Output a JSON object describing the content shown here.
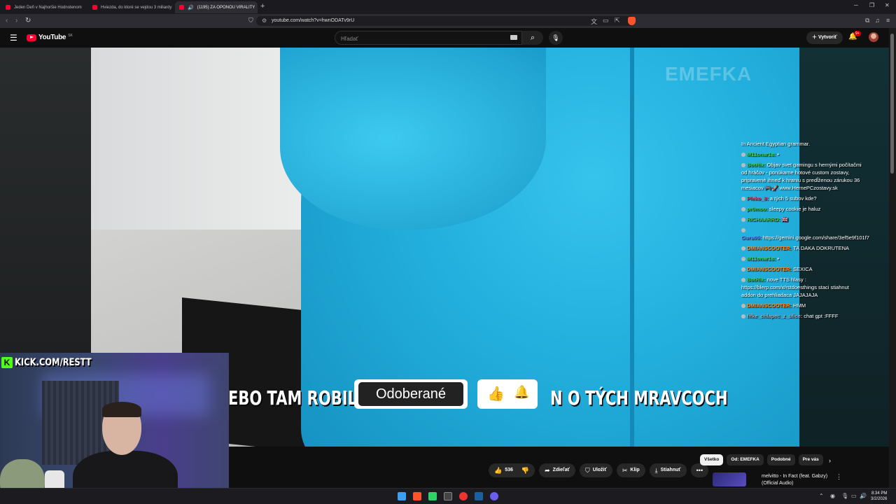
{
  "browser": {
    "tabs": [
      {
        "label": "Jeden Deň v Najhoršie Hodnotenom"
      },
      {
        "label": "Hviezda, do ktoré se vejdou 3 miliardy"
      },
      {
        "label": "(1195) ZA OPONOU VIRALITY"
      }
    ],
    "url": "youtube.com/watch?v=hwnODATv9rU",
    "colors": {
      "brave": "#fb542b",
      "youtube_red": "#ff0033"
    }
  },
  "header": {
    "logo_text": "YouTube",
    "country_code": "SK",
    "search_placeholder": "Hľadať",
    "create_label": "Vytvoriť",
    "notification_count": "9+"
  },
  "video": {
    "watermark": "EMEFKA",
    "caption_left": "EBO TAM ROBIL ZLE",
    "caption_right": "N   O TÝCH MRAVCOCH",
    "subscribed_label": "Odoberané"
  },
  "chat": [
    {
      "user": "",
      "text": "In Ancient Egyptian grammar.",
      "color": "#ffffff"
    },
    {
      "user": "M11onar1s:",
      "text": "▪",
      "color": "#3ad13a"
    },
    {
      "user": "BotRix:",
      "text": "Objav svet gamingu s hernými počítačmi od hráčov - ponúkame hotové custom zostavy, pripravené ihneď k hraniu s predĺženou zárukou 36 mesiacov 🎮🚀 www.HernePCzostavy.sk",
      "color": "#3ad13a"
    },
    {
      "user": "Pleko_8:",
      "text": "a tých 5 subov kde?",
      "color": "#ff3b6b"
    },
    {
      "user": "pr0moo:",
      "text": "sleepy cookie je haluz",
      "color": "#3ad13a"
    },
    {
      "user": "RICHAARRD:",
      "text": "🇬🇧",
      "color": "#3ad13a"
    },
    {
      "user": "Guru05:",
      "text": "https://gemini.google.com/share/3ef5e9f101f7",
      "color": "#6a8cff"
    },
    {
      "user": "DMIANSCOOTER:",
      "text": "TA DAKA DOKRUTENA",
      "color": "#ff8a2a"
    },
    {
      "user": "M11onar1s:",
      "text": "▪",
      "color": "#3ad13a"
    },
    {
      "user": "DMIANSCOOTER:",
      "text": "SEXICA",
      "color": "#ff8a2a"
    },
    {
      "user": "BotRix:",
      "text": "nove TTS hlasy : https://blerp.com/x/rstdoesthings staci stiahnut addon do prehliadaca JAJAJAJA",
      "color": "#3ad13a"
    },
    {
      "user": "DMIANSCOOTER:",
      "text": "HMM",
      "color": "#ff8a2a"
    },
    {
      "user": "fifke_chlapec_z_ulice:",
      "text": "chat gpt :FFFF",
      "color": "#a0a8b8"
    }
  ],
  "webcam": {
    "kick_label": "KICK.COM/RESTT"
  },
  "actions": {
    "like_count": "536",
    "share": "Zdieľať",
    "save": "Uložiť",
    "clip": "Klip",
    "download": "Stiahnuť"
  },
  "chips": [
    "Všetko",
    "Od: EMEFKA",
    "Podobné",
    "Pre vás"
  ],
  "recommended": {
    "title": "melvitto - In Fact (feat. Gabzy) (Official Audio)"
  },
  "taskbar": {
    "time": "8:34 PM",
    "date": "3/2/2026"
  }
}
